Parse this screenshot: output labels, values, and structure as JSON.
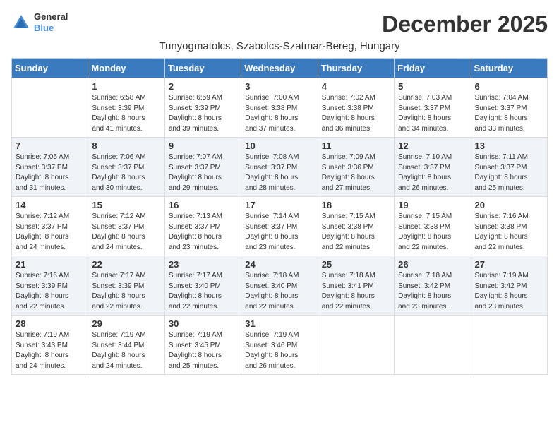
{
  "logo": {
    "line1": "General",
    "line2": "Blue"
  },
  "title": "December 2025",
  "location": "Tunyogmatolcs, Szabolcs-Szatmar-Bereg, Hungary",
  "days_header": [
    "Sunday",
    "Monday",
    "Tuesday",
    "Wednesday",
    "Thursday",
    "Friday",
    "Saturday"
  ],
  "weeks": [
    [
      {
        "day": "",
        "content": ""
      },
      {
        "day": "1",
        "content": "Sunrise: 6:58 AM\nSunset: 3:39 PM\nDaylight: 8 hours\nand 41 minutes."
      },
      {
        "day": "2",
        "content": "Sunrise: 6:59 AM\nSunset: 3:39 PM\nDaylight: 8 hours\nand 39 minutes."
      },
      {
        "day": "3",
        "content": "Sunrise: 7:00 AM\nSunset: 3:38 PM\nDaylight: 8 hours\nand 37 minutes."
      },
      {
        "day": "4",
        "content": "Sunrise: 7:02 AM\nSunset: 3:38 PM\nDaylight: 8 hours\nand 36 minutes."
      },
      {
        "day": "5",
        "content": "Sunrise: 7:03 AM\nSunset: 3:37 PM\nDaylight: 8 hours\nand 34 minutes."
      },
      {
        "day": "6",
        "content": "Sunrise: 7:04 AM\nSunset: 3:37 PM\nDaylight: 8 hours\nand 33 minutes."
      }
    ],
    [
      {
        "day": "7",
        "content": "Sunrise: 7:05 AM\nSunset: 3:37 PM\nDaylight: 8 hours\nand 31 minutes."
      },
      {
        "day": "8",
        "content": "Sunrise: 7:06 AM\nSunset: 3:37 PM\nDaylight: 8 hours\nand 30 minutes."
      },
      {
        "day": "9",
        "content": "Sunrise: 7:07 AM\nSunset: 3:37 PM\nDaylight: 8 hours\nand 29 minutes."
      },
      {
        "day": "10",
        "content": "Sunrise: 7:08 AM\nSunset: 3:37 PM\nDaylight: 8 hours\nand 28 minutes."
      },
      {
        "day": "11",
        "content": "Sunrise: 7:09 AM\nSunset: 3:36 PM\nDaylight: 8 hours\nand 27 minutes."
      },
      {
        "day": "12",
        "content": "Sunrise: 7:10 AM\nSunset: 3:37 PM\nDaylight: 8 hours\nand 26 minutes."
      },
      {
        "day": "13",
        "content": "Sunrise: 7:11 AM\nSunset: 3:37 PM\nDaylight: 8 hours\nand 25 minutes."
      }
    ],
    [
      {
        "day": "14",
        "content": "Sunrise: 7:12 AM\nSunset: 3:37 PM\nDaylight: 8 hours\nand 24 minutes."
      },
      {
        "day": "15",
        "content": "Sunrise: 7:12 AM\nSunset: 3:37 PM\nDaylight: 8 hours\nand 24 minutes."
      },
      {
        "day": "16",
        "content": "Sunrise: 7:13 AM\nSunset: 3:37 PM\nDaylight: 8 hours\nand 23 minutes."
      },
      {
        "day": "17",
        "content": "Sunrise: 7:14 AM\nSunset: 3:37 PM\nDaylight: 8 hours\nand 23 minutes."
      },
      {
        "day": "18",
        "content": "Sunrise: 7:15 AM\nSunset: 3:38 PM\nDaylight: 8 hours\nand 22 minutes."
      },
      {
        "day": "19",
        "content": "Sunrise: 7:15 AM\nSunset: 3:38 PM\nDaylight: 8 hours\nand 22 minutes."
      },
      {
        "day": "20",
        "content": "Sunrise: 7:16 AM\nSunset: 3:38 PM\nDaylight: 8 hours\nand 22 minutes."
      }
    ],
    [
      {
        "day": "21",
        "content": "Sunrise: 7:16 AM\nSunset: 3:39 PM\nDaylight: 8 hours\nand 22 minutes."
      },
      {
        "day": "22",
        "content": "Sunrise: 7:17 AM\nSunset: 3:39 PM\nDaylight: 8 hours\nand 22 minutes."
      },
      {
        "day": "23",
        "content": "Sunrise: 7:17 AM\nSunset: 3:40 PM\nDaylight: 8 hours\nand 22 minutes."
      },
      {
        "day": "24",
        "content": "Sunrise: 7:18 AM\nSunset: 3:40 PM\nDaylight: 8 hours\nand 22 minutes."
      },
      {
        "day": "25",
        "content": "Sunrise: 7:18 AM\nSunset: 3:41 PM\nDaylight: 8 hours\nand 22 minutes."
      },
      {
        "day": "26",
        "content": "Sunrise: 7:18 AM\nSunset: 3:42 PM\nDaylight: 8 hours\nand 23 minutes."
      },
      {
        "day": "27",
        "content": "Sunrise: 7:19 AM\nSunset: 3:42 PM\nDaylight: 8 hours\nand 23 minutes."
      }
    ],
    [
      {
        "day": "28",
        "content": "Sunrise: 7:19 AM\nSunset: 3:43 PM\nDaylight: 8 hours\nand 24 minutes."
      },
      {
        "day": "29",
        "content": "Sunrise: 7:19 AM\nSunset: 3:44 PM\nDaylight: 8 hours\nand 24 minutes."
      },
      {
        "day": "30",
        "content": "Sunrise: 7:19 AM\nSunset: 3:45 PM\nDaylight: 8 hours\nand 25 minutes."
      },
      {
        "day": "31",
        "content": "Sunrise: 7:19 AM\nSunset: 3:46 PM\nDaylight: 8 hours\nand 26 minutes."
      },
      {
        "day": "",
        "content": ""
      },
      {
        "day": "",
        "content": ""
      },
      {
        "day": "",
        "content": ""
      }
    ]
  ]
}
